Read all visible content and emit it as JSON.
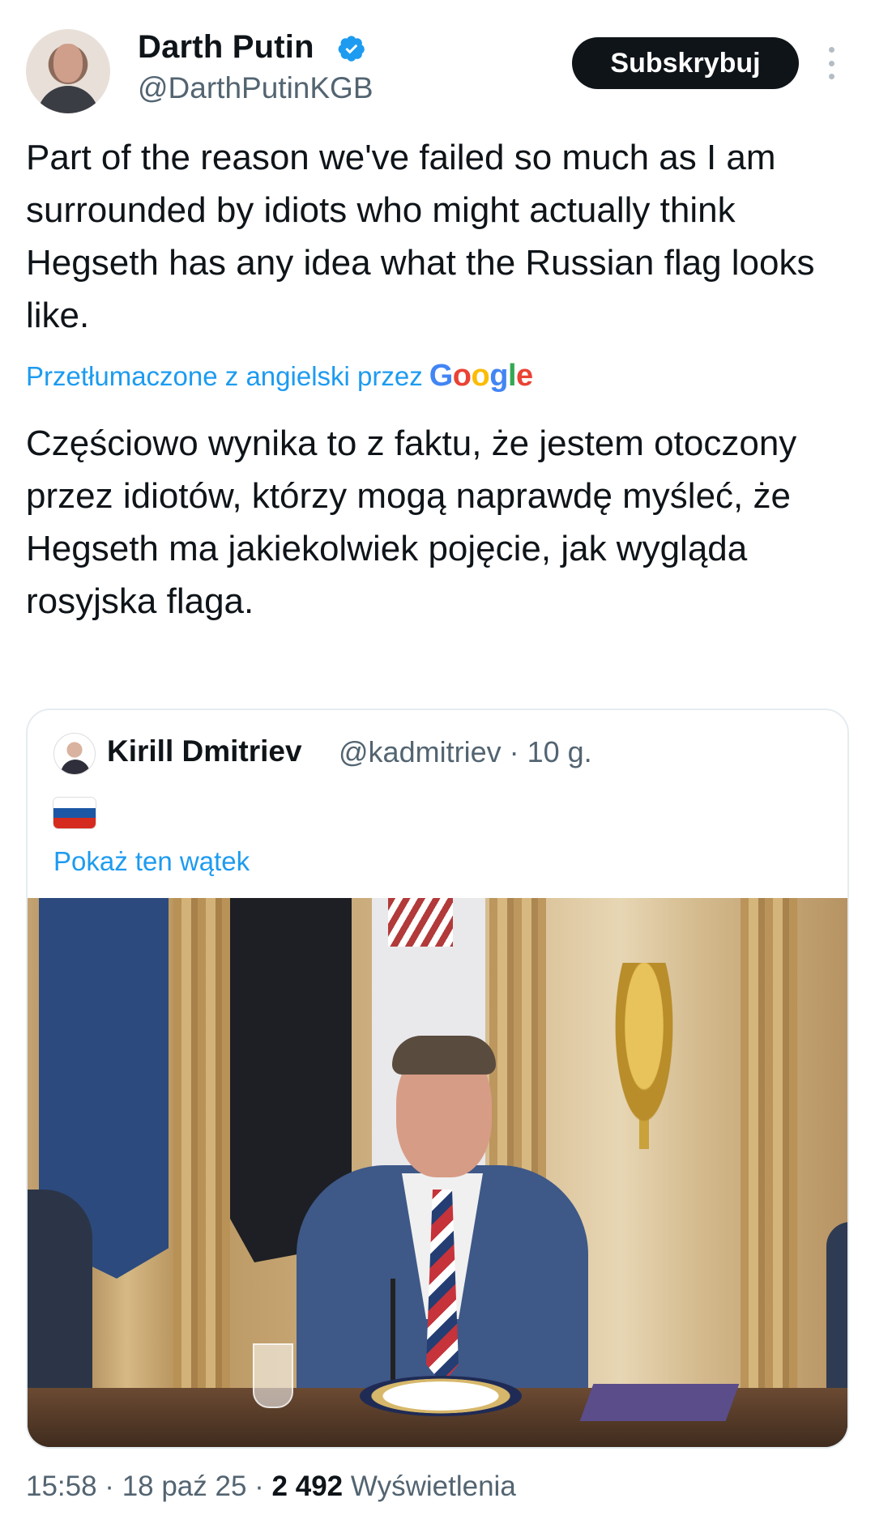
{
  "author": {
    "display_name": "Darth Putin",
    "handle": "@DarthPutinKGB",
    "verified": true
  },
  "actions": {
    "subscribe_label": "Subskrybuj"
  },
  "tweet": {
    "text": "Part of the reason we've failed so much as I am surrounded by idiots who might actually think Hegseth has any idea what the Russian flag looks like.",
    "translated_by_label": "Przetłumaczone z angielski przez",
    "translator_logo": "Google",
    "translation": "Częściowo wynika to z faktu, że jestem otoczony przez idiotów, którzy mogą naprawdę myśleć, że Hegseth ma jakiekolwiek pojęcie, jak wygląda rosyjska flaga."
  },
  "quoted_tweet": {
    "display_name": "Kirill Dmitriev",
    "handle_time": "@kadmitriev · 10 g.",
    "flag_icon": "russian-flag",
    "show_thread_label": "Pokaż ten wątek"
  },
  "meta": {
    "time_date": "15:58 · 18 paź 25 · ",
    "views_count": "2 492",
    "views_label": " Wyświetlenia"
  },
  "colors": {
    "accent": "#1d9bf0",
    "text": "#0f1419",
    "secondary": "#536471"
  }
}
